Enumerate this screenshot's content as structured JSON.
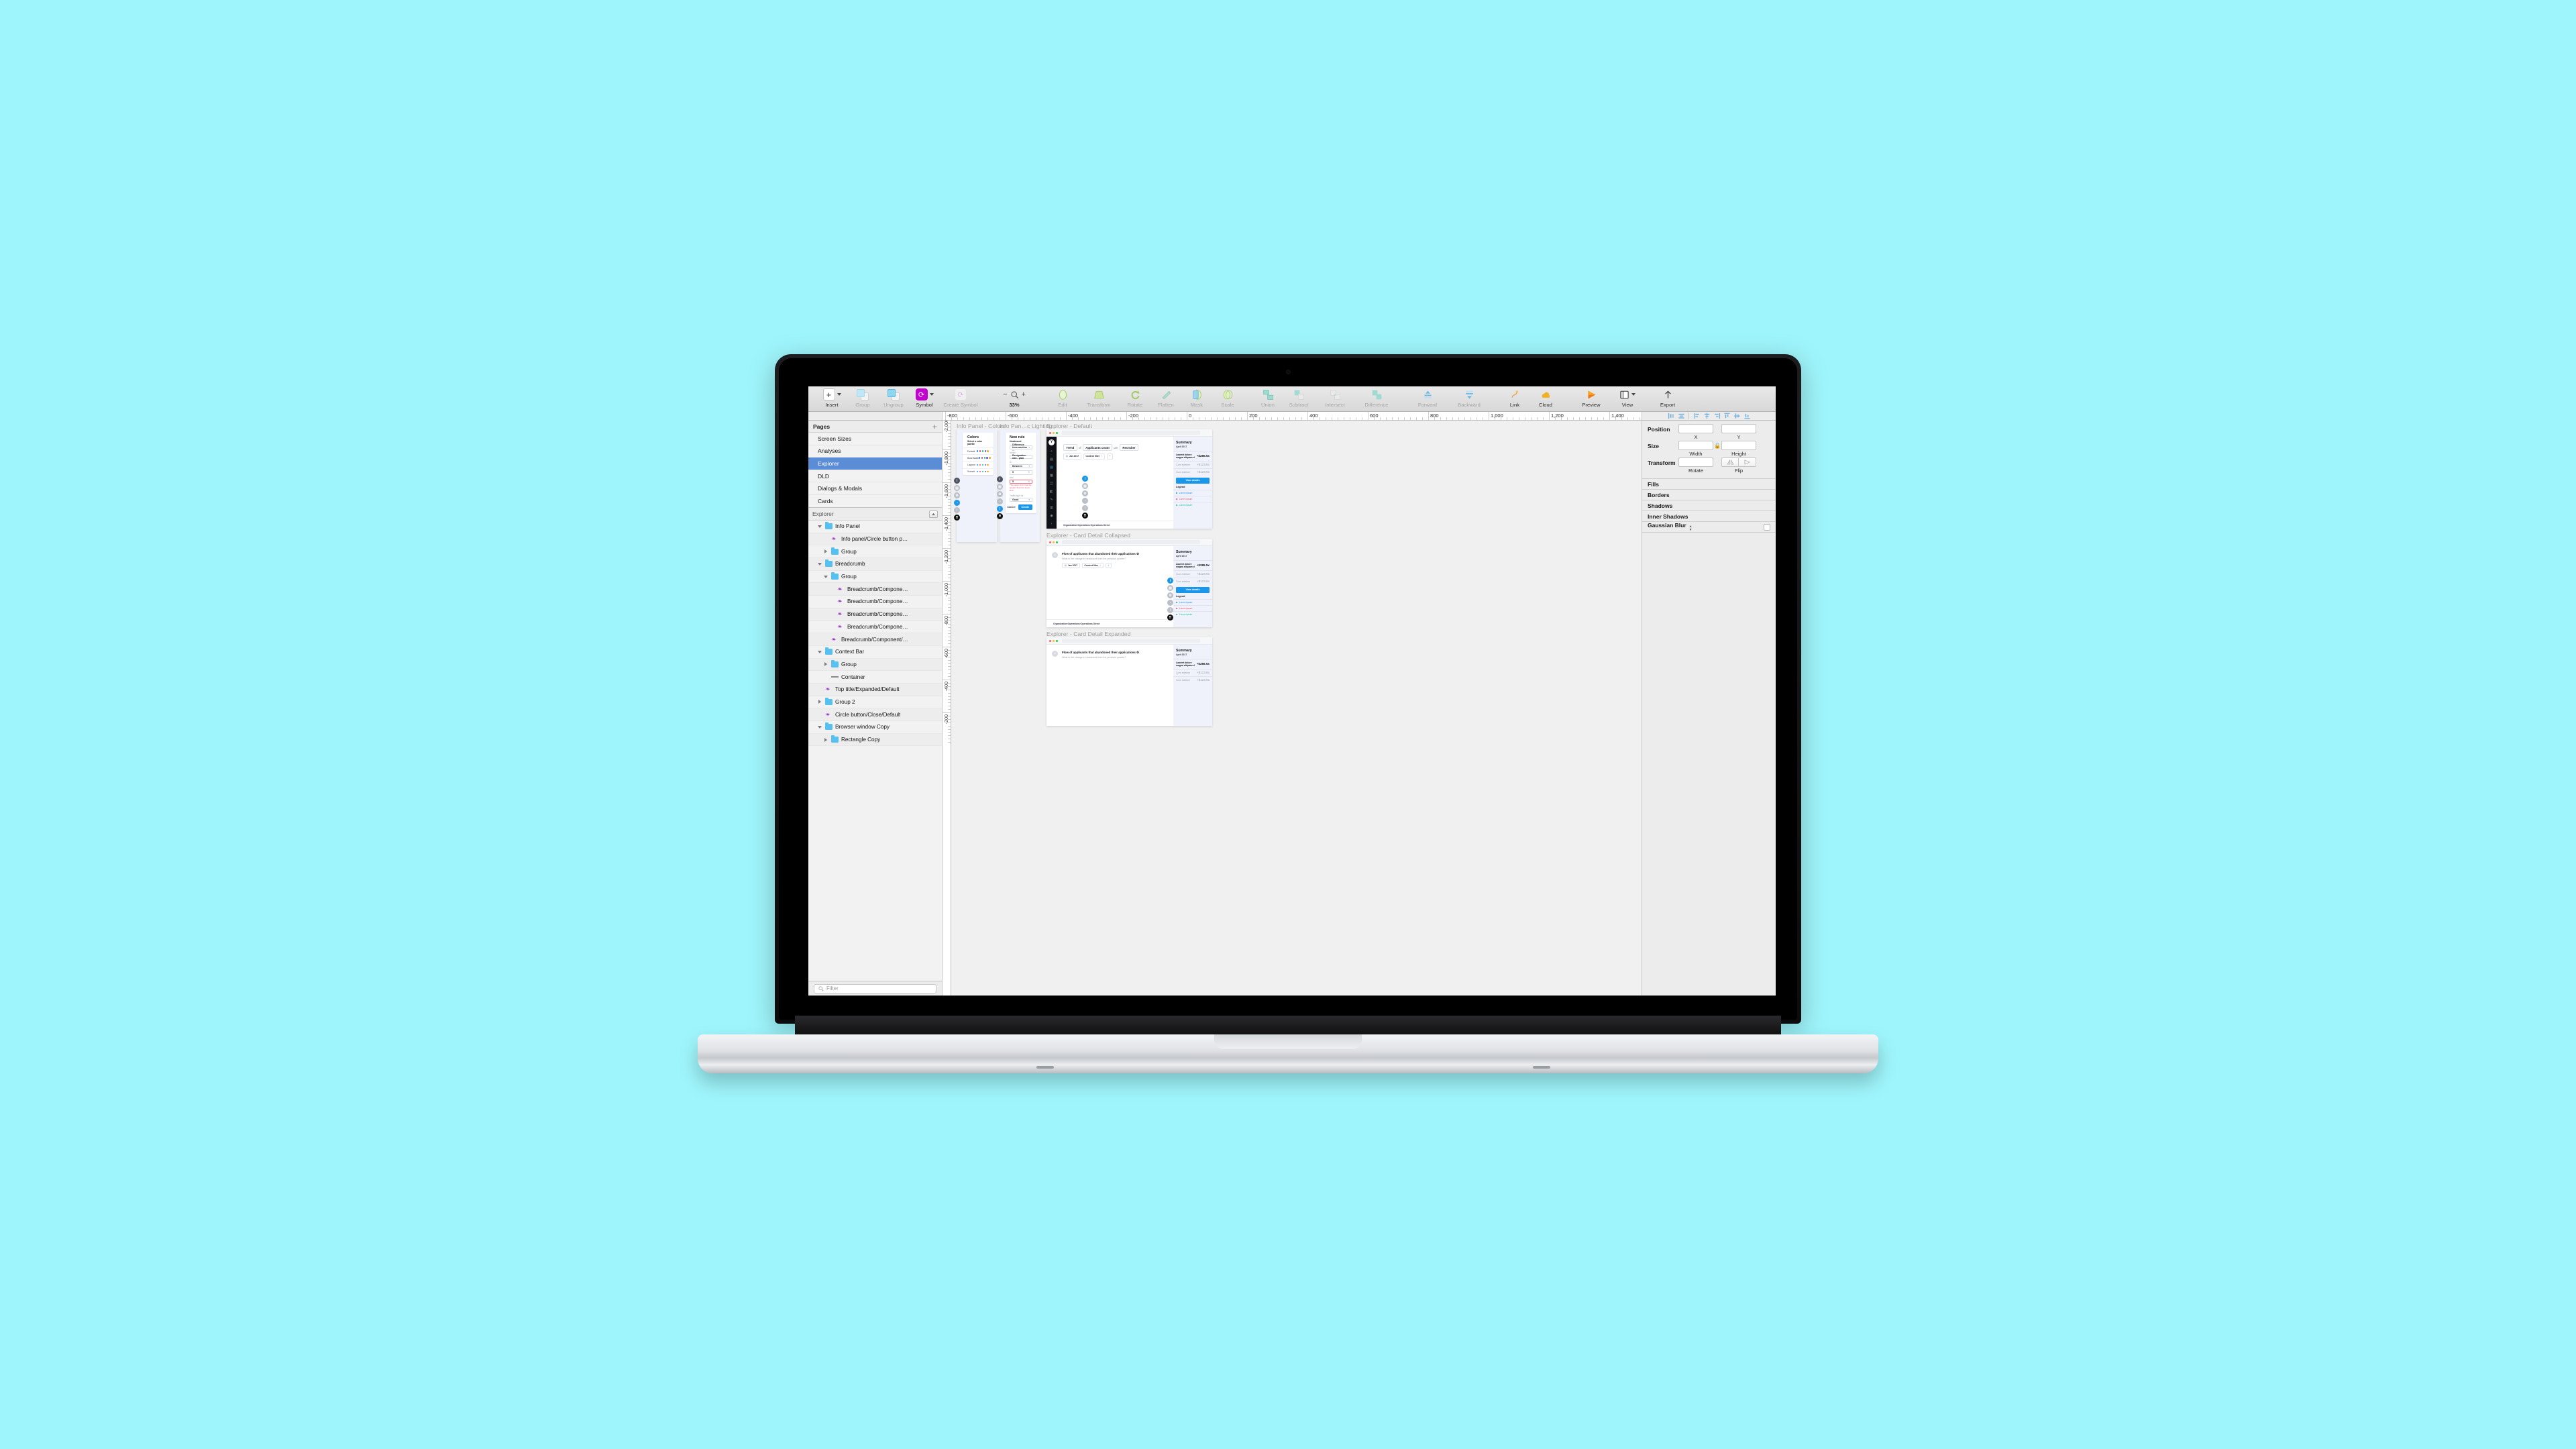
{
  "app": {
    "name": "Sketch",
    "zoom_level": "33%"
  },
  "toolbar": {
    "items": [
      {
        "label": "Insert",
        "icon": "plus-icon",
        "has_dropdown": true,
        "enabled": true
      },
      {
        "label": "Group",
        "icon": "group-icon",
        "enabled": false
      },
      {
        "label": "Ungroup",
        "icon": "ungroup-icon",
        "enabled": false
      },
      {
        "label": "Symbol",
        "icon": "symbol-icon",
        "has_dropdown": true,
        "enabled": true
      },
      {
        "label": "Create Symbol",
        "icon": "create-symbol-icon",
        "enabled": false
      },
      {
        "label": "Edit",
        "icon": "edit-icon",
        "enabled": false
      },
      {
        "label": "Transform",
        "icon": "transform-icon",
        "enabled": false
      },
      {
        "label": "Rotate",
        "icon": "rotate-icon",
        "enabled": false
      },
      {
        "label": "Flatten",
        "icon": "flatten-icon",
        "enabled": false
      },
      {
        "label": "Mask",
        "icon": "mask-icon",
        "enabled": false
      },
      {
        "label": "Scale",
        "icon": "scale-icon",
        "enabled": false
      },
      {
        "label": "Union",
        "icon": "union-icon",
        "enabled": false
      },
      {
        "label": "Subtract",
        "icon": "subtract-icon",
        "enabled": false
      },
      {
        "label": "Intersect",
        "icon": "intersect-icon",
        "enabled": false
      },
      {
        "label": "Difference",
        "icon": "difference-icon",
        "enabled": false
      },
      {
        "label": "Forward",
        "icon": "forward-icon",
        "enabled": false
      },
      {
        "label": "Backward",
        "icon": "backward-icon",
        "enabled": false
      },
      {
        "label": "Link",
        "icon": "link-icon",
        "enabled": true
      },
      {
        "label": "Cloud",
        "icon": "cloud-icon",
        "enabled": true
      },
      {
        "label": "Preview",
        "icon": "preview-icon",
        "enabled": true
      },
      {
        "label": "View",
        "icon": "view-icon",
        "has_dropdown": true,
        "enabled": true
      },
      {
        "label": "Export",
        "icon": "export-icon",
        "enabled": true
      }
    ],
    "zoom_out_icon": "minus-icon",
    "zoom_icon": "magnifier-icon",
    "zoom_in_icon": "plus-icon"
  },
  "rulers": {
    "horizontal_labels": [
      "-800",
      "-600",
      "-400",
      "-200",
      "0",
      "200",
      "400",
      "600",
      "800",
      "1,000",
      "1,200",
      "1,400"
    ],
    "vertical_labels": [
      "-2,000",
      "-1,800",
      "-1,600",
      "-1,400",
      "-1,200",
      "-1,000",
      "-800",
      "-600",
      "-400",
      "-200"
    ]
  },
  "align_tools": [
    "align-left-icon",
    "align-center-horizontal-icon",
    "distribute-left-icon",
    "distribute-center-icon",
    "distribute-right-icon",
    "align-top-icon",
    "align-middle-icon",
    "align-bottom-icon"
  ],
  "pages_panel": {
    "title": "Pages",
    "add_icon": "plus-icon",
    "items": [
      {
        "label": "Screen Sizes",
        "selected": false
      },
      {
        "label": "Analyses",
        "selected": false
      },
      {
        "label": "Explorer",
        "selected": true
      },
      {
        "label": "DLD",
        "selected": false
      },
      {
        "label": "Dialogs & Modals",
        "selected": false
      },
      {
        "label": "Cards",
        "selected": false
      }
    ]
  },
  "layers_panel": {
    "title": "Explorer",
    "collapse_icon": "collapse-icon",
    "filter_placeholder": "Filter",
    "filter_icon": "search-icon",
    "items": [
      {
        "label": "Info Panel",
        "indent": 1,
        "type": "folder",
        "disclosure": "down"
      },
      {
        "label": "Info panel/Circle button p…",
        "indent": 2,
        "type": "symbol",
        "disclosure": "none"
      },
      {
        "label": "Group",
        "indent": 2,
        "type": "folder",
        "disclosure": "right"
      },
      {
        "label": "Breadcrumb",
        "indent": 1,
        "type": "folder",
        "disclosure": "down"
      },
      {
        "label": "Group",
        "indent": 2,
        "type": "folder",
        "disclosure": "down"
      },
      {
        "label": "Breadcrumb/Compone…",
        "indent": 3,
        "type": "symbol",
        "disclosure": "none"
      },
      {
        "label": "Breadcrumb/Compone…",
        "indent": 3,
        "type": "symbol",
        "disclosure": "none"
      },
      {
        "label": "Breadcrumb/Compone…",
        "indent": 3,
        "type": "symbol",
        "disclosure": "none"
      },
      {
        "label": "Breadcrumb/Compone…",
        "indent": 3,
        "type": "symbol",
        "disclosure": "none"
      },
      {
        "label": "Breadcrumb/Component/…",
        "indent": 2,
        "type": "symbol",
        "disclosure": "none"
      },
      {
        "label": "Context Bar",
        "indent": 1,
        "type": "folder",
        "disclosure": "down"
      },
      {
        "label": "Group",
        "indent": 2,
        "type": "folder",
        "disclosure": "right"
      },
      {
        "label": "Container",
        "indent": 2,
        "type": "line",
        "disclosure": "none"
      },
      {
        "label": "Top title/Expanded/Default",
        "indent": 1,
        "type": "symbol",
        "disclosure": "none"
      },
      {
        "label": "Group 2",
        "indent": 1,
        "type": "folder",
        "disclosure": "right"
      },
      {
        "label": "Circle button/Close/Default",
        "indent": 1,
        "type": "symbol",
        "disclosure": "none"
      },
      {
        "label": "Browser window Copy",
        "indent": 1,
        "type": "folder",
        "disclosure": "down"
      },
      {
        "label": "Rectangle Copy",
        "indent": 2,
        "type": "folder",
        "disclosure": "right"
      }
    ]
  },
  "inspector": {
    "position": {
      "label": "Position",
      "x_value": "",
      "x_sub": "X",
      "y_value": "",
      "y_sub": "Y"
    },
    "size": {
      "label": "Size",
      "width_value": "",
      "width_sub": "Width",
      "height_value": "",
      "height_sub": "Height",
      "lock_icon": "lock-open-icon"
    },
    "transform": {
      "label": "Transform",
      "rotate_value": "",
      "rotate_sub": "Rotate",
      "flip_sub": "Flip",
      "flip_h_icon": "flip-horizontal-icon",
      "flip_v_icon": "flip-vertical-icon"
    },
    "sections": [
      {
        "label": "Fills",
        "has_checkbox": false
      },
      {
        "label": "Borders",
        "has_checkbox": false
      },
      {
        "label": "Shadows",
        "has_checkbox": false
      },
      {
        "label": "Inner Shadows",
        "has_checkbox": false
      },
      {
        "label": "Gaussian Blur",
        "has_checkbox": true,
        "has_stepper": true
      }
    ]
  },
  "canvas": {
    "artboards": [
      {
        "title": "Info Panel - Colors"
      },
      {
        "title": "Info Pan…c Lighting"
      },
      {
        "title": "Explorer - Default"
      },
      {
        "title": "Explorer - Card Detail Collapsed"
      },
      {
        "title": "Explorer - Card Detail Expanded"
      }
    ],
    "info_colors": {
      "heading": "Colors",
      "subheading": "Select a color palette",
      "rows": [
        {
          "name": "Default",
          "swatches": [
            "#1f8ef1",
            "#ef4f66",
            "#19c3a3",
            "#6a5bd6",
            "#f5a623"
          ]
        },
        {
          "name": "Boardwalk",
          "swatches": [
            "#1f8ef1",
            "#ef4f66",
            "#19c3a3",
            "#6a5bd6",
            "#f5a623"
          ]
        },
        {
          "name": "Lagoon",
          "swatches": [
            "#1f8ef1",
            "#ef4f66",
            "#19c3a3",
            "#6a5bd6",
            "#f5a623"
          ]
        },
        {
          "name": "Sunset",
          "swatches": [
            "#1f8ef1",
            "#ef4f66",
            "#19c3a3",
            "#6a5bd6",
            "#f5a623"
          ]
        }
      ],
      "rail_buttons": [
        "info-icon",
        "add-panel-icon",
        "settings-icon",
        "palette-icon",
        "alert-icon",
        "drag-handle-icon"
      ]
    },
    "info_lighting": {
      "heading": "New rule",
      "subheading": "Headcount",
      "rule_type": "Difference from another …",
      "metric_label": "Metric",
      "metric_value": "Resignation rate - plan",
      "is_label": "Is",
      "is_value": "Between",
      "lower_value": "5",
      "lower_unit": "%",
      "and_label": "and",
      "upper_value": "5",
      "upper_unit": "%",
      "error": "The upper limit must be greater than the lower limit",
      "traffic_label": "Traffic light as",
      "traffic_value": "Good",
      "cancel_label": "Cancel",
      "create_label": "Create",
      "rail_buttons": [
        "info-icon",
        "add-panel-icon",
        "settings-icon",
        "palette-icon",
        "alert-icon",
        "drag-handle-icon"
      ]
    },
    "explorer_default": {
      "query": {
        "verb": "Trend",
        "of": "of",
        "measure": "Applicants count",
        "per": "per",
        "dimension": "Recruiter"
      },
      "chips": [
        {
          "label": "Jan 2017",
          "icon": "calendar-icon"
        },
        {
          "label": "Context filter",
          "removable": true
        }
      ],
      "add_chip_icon": "plus-icon",
      "summary": {
        "title": "Summary",
        "date": "April 2017",
        "rows": [
          {
            "key": "Laoreet dolore magna aliquam d",
            "value": "+$285.5x",
            "muted": false
          },
          {
            "key": "Cons ectetuer",
            "value": "+$123.8x",
            "muted": true
          },
          {
            "key": "Cons ectetuer",
            "value": "+$123.8x",
            "muted": true
          }
        ],
        "button": "View details",
        "legend_title": "Legend",
        "legend": [
          {
            "label": "Lorem ipsum",
            "color": "#1f8ef1"
          },
          {
            "label": "Lorem ipsum",
            "color": "#ef4f66"
          },
          {
            "label": "Lorem ipsum",
            "color": "#19c3a3"
          }
        ]
      },
      "breadcrumb": [
        "Organization",
        "Operations",
        "Operations Direct"
      ],
      "nav_icons": [
        "search-icon",
        "book-icon",
        "chart-icon",
        "table-icon",
        "grid-icon",
        "compare-icon",
        "pencil-icon",
        "bar-icon",
        "clock-icon",
        "chevron-right-icon"
      ],
      "logo": "Y",
      "window_controls": [
        "#ff5f57",
        "#febc2e",
        "#28c840"
      ]
    },
    "card_detail": {
      "title": "Flow of applicants that abandoned their applications",
      "title_icon": "settings-icon",
      "subtitle": "What is the change in headcount from the previous quarter?",
      "close_icon": "close-icon",
      "chips": [
        {
          "label": "Jan 2017",
          "icon": "calendar-icon"
        },
        {
          "label": "Context filter",
          "removable": true
        }
      ],
      "add_chip_icon": "plus-icon"
    }
  }
}
